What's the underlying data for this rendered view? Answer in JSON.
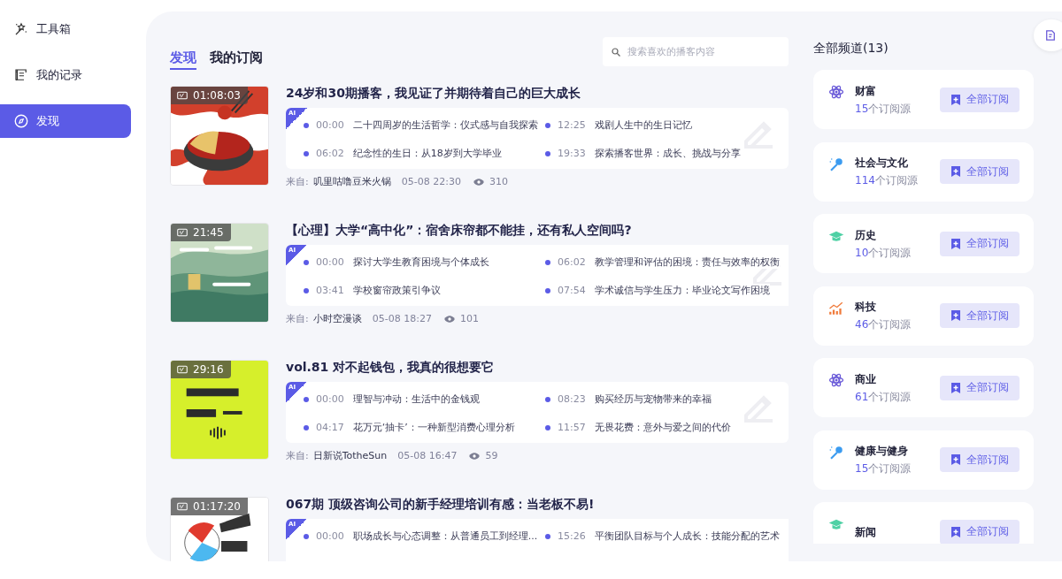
{
  "sidebar": {
    "items": [
      {
        "label": "工具箱",
        "selected": false
      },
      {
        "label": "我的记录",
        "selected": false
      },
      {
        "label": "发现",
        "selected": true
      }
    ]
  },
  "tabs": [
    {
      "label": "发现",
      "selected": true
    },
    {
      "label": "我的订阅",
      "selected": false
    }
  ],
  "search": {
    "placeholder": "搜索喜欢的播客内容"
  },
  "episodes": [
    {
      "title": "24岁和30期播客，我见证了并期待着自己的巨大成长",
      "duration": "01:08:03",
      "ai_badge": "AI",
      "cover": {
        "kind": "picture"
      },
      "chapters": [
        {
          "time": "00:00",
          "text": "二十四周岁的生活哲学：仪式感与自我探索"
        },
        {
          "time": "12:25",
          "text": "戏剧人生中的生日记忆"
        },
        {
          "time": "06:02",
          "text": "纪念性的生日：从18岁到大学毕业"
        },
        {
          "time": "19:33",
          "text": "探索播客世界：成长、挑战与分享"
        }
      ],
      "source_label": "来自:",
      "source": "叽里咕噜豆米火锅",
      "date": "05-08 22:30",
      "views": "310"
    },
    {
      "title": "【心理】大学“高中化”：宿舍床帘都不能挂，还有私人空间吗?",
      "duration": "21:45",
      "ai_badge": "AI",
      "cover": {
        "kind": "picture"
      },
      "chapters": [
        {
          "time": "00:00",
          "text": "探讨大学生教育困境与个体成长"
        },
        {
          "time": "06:02",
          "text": "教学管理和评估的困境：责任与效率的权衡"
        },
        {
          "time": "03:41",
          "text": "学校窗帘政策引争议"
        },
        {
          "time": "07:54",
          "text": "学术诚信与学生压力：毕业论文写作困境"
        }
      ],
      "source_label": "来自:",
      "source": "小时空漫谈",
      "date": "05-08 18:27",
      "views": "101"
    },
    {
      "title": "vol.81 对不起钱包，我真的很想要它",
      "duration": "29:16",
      "ai_badge": "AI",
      "cover": {
        "kind": "picture"
      },
      "chapters": [
        {
          "time": "00:00",
          "text": "理智与冲动：生活中的金钱观"
        },
        {
          "time": "08:23",
          "text": "购买经历与宠物带来的幸福"
        },
        {
          "time": "04:17",
          "text": "花万元‘抽卡’：一种新型消费心理分析"
        },
        {
          "time": "11:57",
          "text": "无畏花费：意外与爱之间的代价"
        }
      ],
      "source_label": "来自:",
      "source": "日新说TotheSun",
      "date": "05-08 16:47",
      "views": "59"
    },
    {
      "title": "067期 顶级咨询公司的新手经理培训有感：当老板不易!",
      "duration": "01:17:20",
      "ai_badge": "AI",
      "cover": {
        "kind": "picture"
      },
      "chapters": [
        {
          "time": "00:00",
          "text": "职场成长与心态调整：从普通员工到经理..."
        },
        {
          "time": "15:26",
          "text": "平衡团队目标与个人成长：技能分配的艺术"
        }
      ]
    }
  ],
  "channels_header": "全部频道(13)",
  "channels": [
    {
      "name": "财富",
      "count": "15",
      "unit": "个订阅源",
      "kind": "atom",
      "button": "全部订阅"
    },
    {
      "name": "社会与文化",
      "count": "114",
      "unit": "个订阅源",
      "kind": "mic",
      "button": "全部订阅"
    },
    {
      "name": "历史",
      "count": "10",
      "unit": "个订阅源",
      "kind": "cap",
      "button": "全部订阅"
    },
    {
      "name": "科技",
      "count": "46",
      "unit": "个订阅源",
      "kind": "chart",
      "button": "全部订阅"
    },
    {
      "name": "商业",
      "count": "61",
      "unit": "个订阅源",
      "kind": "atom",
      "button": "全部订阅"
    },
    {
      "name": "健康与健身",
      "count": "15",
      "unit": "个订阅源",
      "kind": "mic",
      "button": "全部订阅"
    },
    {
      "name": "新闻",
      "kind": "cap",
      "button": "全部订阅"
    }
  ]
}
